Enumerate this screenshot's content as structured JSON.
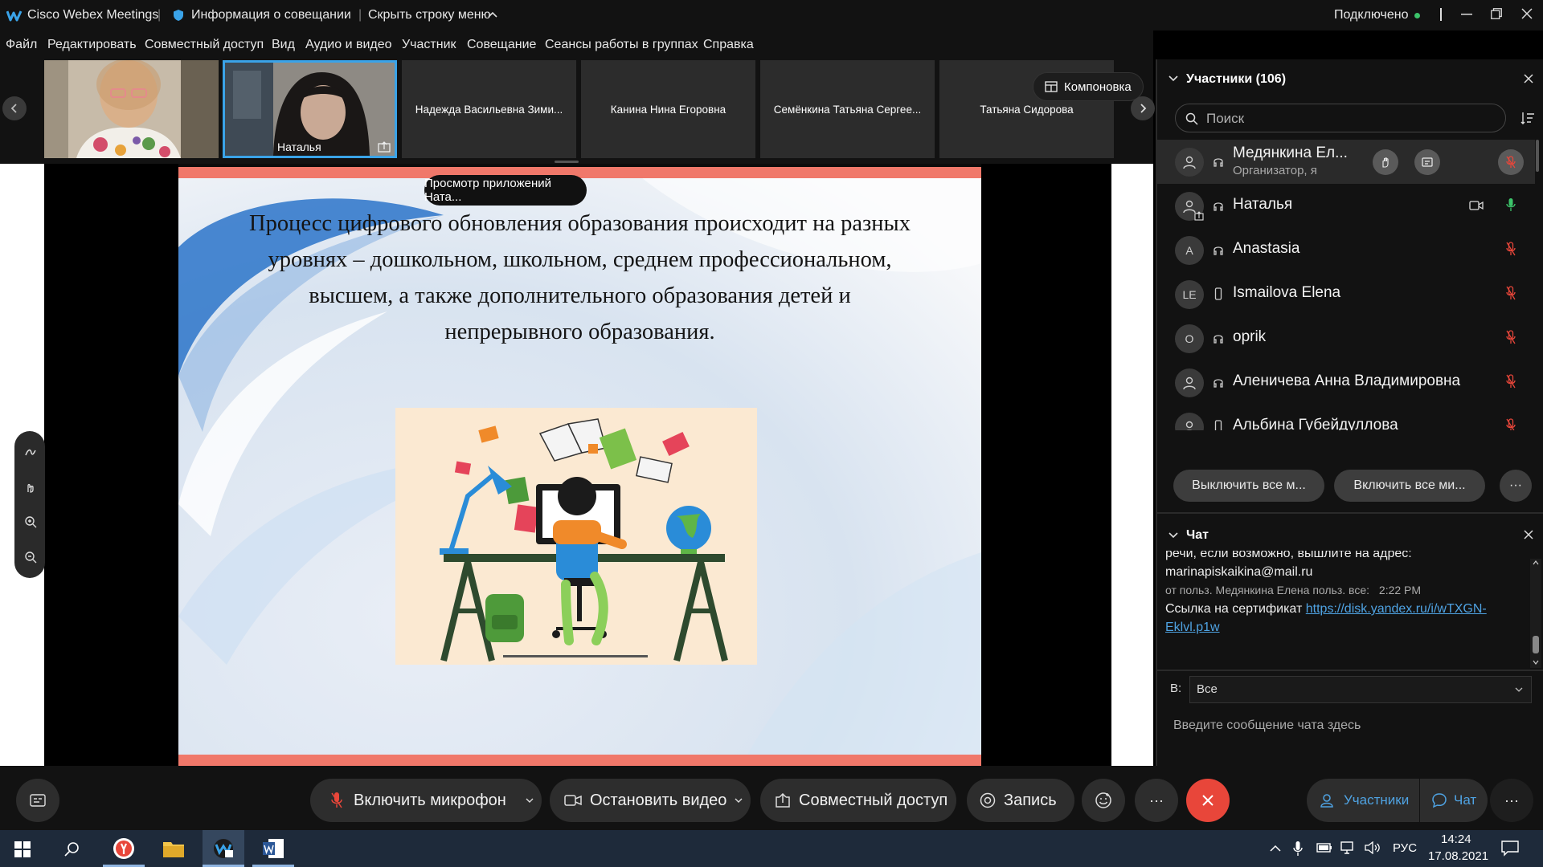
{
  "window": {
    "app_title": "Cisco Webex Meetings",
    "meeting_info": "Информация о совещании",
    "hide_menu": "Скрыть строку меню",
    "connection_status": "Подключено"
  },
  "menu": [
    "Файл",
    "Редактировать",
    "Совместный доступ",
    "Вид",
    "Аудио и видео",
    "Участник",
    "Совещание",
    "Сеансы работы в группах",
    "Справка"
  ],
  "thumbnails": {
    "active_name": "Наталья",
    "tiles": [
      "Надежда Васильевна Зими...",
      "Канина Нина Егоровна",
      "Семёнкина Татьяна Сергее...",
      "Татьяна Сидорова"
    ],
    "layout_button": "Компоновка"
  },
  "stage": {
    "viewing_label": "Просмотр приложений Ната...",
    "slide_text_lines": [
      "Процесс цифрового обновления образования происходит на разных",
      "уровнях – дошкольном, школьном, среднем профессиональном,",
      "высшем, а также дополнительного образования детей и",
      "непрерывного образования."
    ]
  },
  "participants": {
    "title": "Участники (106)",
    "search_placeholder": "Поиск",
    "list": [
      {
        "avatar": "",
        "name": "Медянкина Ел...",
        "role": "Организатор, я"
      },
      {
        "avatar": "",
        "name": "Наталья"
      },
      {
        "avatar": "A",
        "name": "Anastasia"
      },
      {
        "avatar": "LE",
        "name": "Ismailova Elena"
      },
      {
        "avatar": "O",
        "name": "oprik"
      },
      {
        "avatar": "",
        "name": "Аленичева Анна Владимировна"
      },
      {
        "avatar": "",
        "name": "Альбина Губейдуллова"
      }
    ],
    "mute_all": "Выключить все м...",
    "unmute_all": "Включить все ми...",
    "more": "···"
  },
  "chat": {
    "title": "Чат",
    "messages": {
      "line1": "речи, если возможно, вышлите на адрес:",
      "line2": "marinapiskaikina@mail.ru",
      "meta": "от польз. Медянкина Елена польз. все:",
      "time": "2:22 PM",
      "cert_text": "Ссылка на сертификат",
      "cert_link_1": "https://disk.yandex.ru/i/wTXGN-",
      "cert_link_2": "Eklvl.p1w"
    },
    "to_label": "В:",
    "to_value": "Все",
    "input_placeholder": "Введите сообщение чата здесь"
  },
  "controls": {
    "unmute": "Включить микрофон",
    "stop_video": "Остановить видео",
    "share": "Совместный доступ",
    "record": "Запись",
    "more": "···",
    "participants": "Участники",
    "chat": "Чат",
    "right_more": "···"
  },
  "taskbar": {
    "lang": "РУС",
    "time": "14:24",
    "date": "17.08.2021"
  },
  "colors": {
    "accent_blue": "#4fa3e3",
    "leave_red": "#e8463a",
    "active_border": "#3aa3e8",
    "slide_salmon": "#f0786a"
  }
}
